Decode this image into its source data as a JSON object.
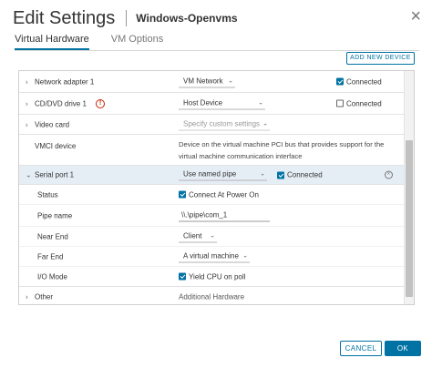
{
  "dialog": {
    "title": "Edit Settings",
    "vm_name": "Windows-Openvms",
    "close_glyph": "×"
  },
  "tabs": [
    {
      "label": "Virtual Hardware",
      "active": true
    },
    {
      "label": "VM Options",
      "active": false
    }
  ],
  "add_device_label": "ADD NEW DEVICE",
  "rows": {
    "network": {
      "label": "Network adapter 1",
      "value": "VM Network",
      "connected_label": "Connected",
      "connected": true
    },
    "cddvd": {
      "label": "CD/DVD drive 1",
      "value": "Host Device",
      "connected_label": "Connected",
      "connected": false,
      "warning_glyph": "!"
    },
    "video": {
      "label": "Video card",
      "value": "Specify custom settings"
    },
    "vmci": {
      "label": "VMCI device",
      "description": "Device on the virtual machine PCI bus that provides support for the virtual machine communication interface"
    },
    "serial": {
      "label": "Serial port 1",
      "value": "Use named pipe",
      "connected_label": "Connected",
      "connected": true,
      "status": {
        "label": "Status",
        "option_label": "Connect At Power On",
        "checked": true
      },
      "pipe_name": {
        "label": "Pipe name",
        "value": "\\\\.\\pipe\\com_1"
      },
      "near_end": {
        "label": "Near End",
        "value": "Client"
      },
      "far_end": {
        "label": "Far End",
        "value": "A virtual machine"
      },
      "io_mode": {
        "label": "I/O Mode",
        "option_label": "Yield CPU on poll",
        "checked": true
      }
    },
    "other": {
      "label": "Other",
      "value": "Additional Hardware"
    }
  },
  "glyphs": {
    "chevron_right": "›",
    "chevron_down": "⌄",
    "caret": "⌄",
    "remove": "×"
  },
  "footer": {
    "cancel_label": "CANCEL",
    "ok_label": "OK"
  },
  "colors": {
    "accent": "#0072a3",
    "highlight_row": "#e6eef5",
    "warning": "#c92100"
  }
}
